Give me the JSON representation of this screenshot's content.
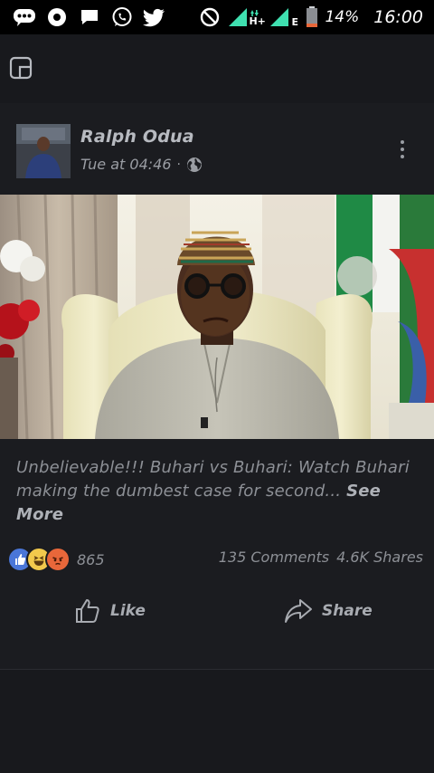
{
  "status_bar": {
    "battery_percent": "14%",
    "time": "16:00",
    "network_label": "H+",
    "network_label_2": "E",
    "icons": [
      "messenger-icon",
      "record-icon",
      "chat-icon",
      "whatsapp-icon",
      "twitter-icon",
      "do-not-disturb-icon",
      "signal-icon",
      "signal-icon-2",
      "battery-icon"
    ]
  },
  "post": {
    "author": "Ralph Odua",
    "timestamp": "Tue at 04:46",
    "separator": "·",
    "privacy_icon": "globe-icon",
    "caption": "Unbelievable!!! Buhari vs Buhari: Watch Buhari making the dumbest  case for second...",
    "see_more": "See More",
    "reactions": {
      "types": [
        "like",
        "haha",
        "angry"
      ],
      "count": "865"
    },
    "comments": "135 Comments",
    "shares": "4.6K Shares"
  },
  "actions": {
    "like_label": "Like",
    "share_label": "Share"
  },
  "colors": {
    "background": "#18191d",
    "like_blue": "#4a76d8",
    "haha_yellow": "#f2c94c",
    "angry_orange": "#e8673a"
  }
}
